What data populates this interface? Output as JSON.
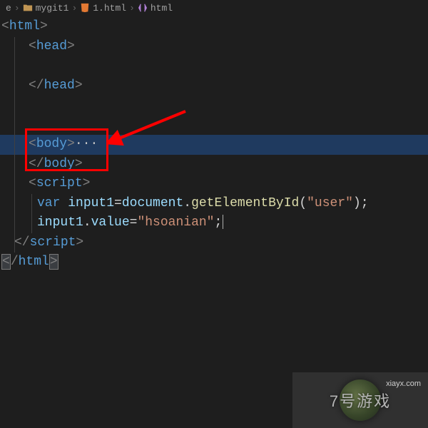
{
  "breadcrumb": {
    "parent_prefix": "e",
    "folder": "mygit1",
    "file": "1.html",
    "symbol": "html"
  },
  "code": {
    "html_open": "html",
    "head_open": "head",
    "head_close": "head",
    "body_open": "body",
    "body_dots": "···",
    "body_close": "body",
    "script_open": "script",
    "var_kw": "var",
    "var1_name": "input1",
    "doc_ident": "document",
    "method": "getElementById",
    "arg_string": "\"user\"",
    "value_prop": "value",
    "value_string": "\"hsoanian\"",
    "script_close": "script",
    "html_close": "html"
  },
  "annotation": {
    "highlight_color": "#ff0000",
    "arrow_color": "#ff0000"
  },
  "watermark": {
    "text": "7号游戏",
    "url": "xiayx.com"
  }
}
